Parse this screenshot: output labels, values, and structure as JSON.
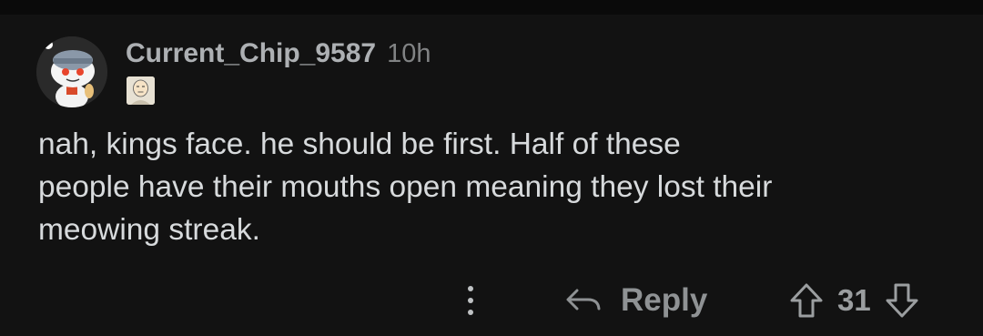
{
  "comment": {
    "username": "Current_Chip_9587",
    "timestamp": "10h",
    "body": "nah, kings face. he should be first. Half of these\npeople have their mouths open meaning they lost their\nmeowing streak.",
    "avatar_icon": "snoo-avatar-icon",
    "flair_icon": "user-flair-icon"
  },
  "actions": {
    "more_icon": "more-options-icon",
    "reply_icon": "reply-arrow-icon",
    "reply_label": "Reply",
    "upvote_icon": "upvote-arrow-icon",
    "vote_count": "31",
    "downvote_icon": "downvote-arrow-icon"
  },
  "colors": {
    "background": "#121212",
    "text": "#d7dadc",
    "muted": "#818384"
  }
}
